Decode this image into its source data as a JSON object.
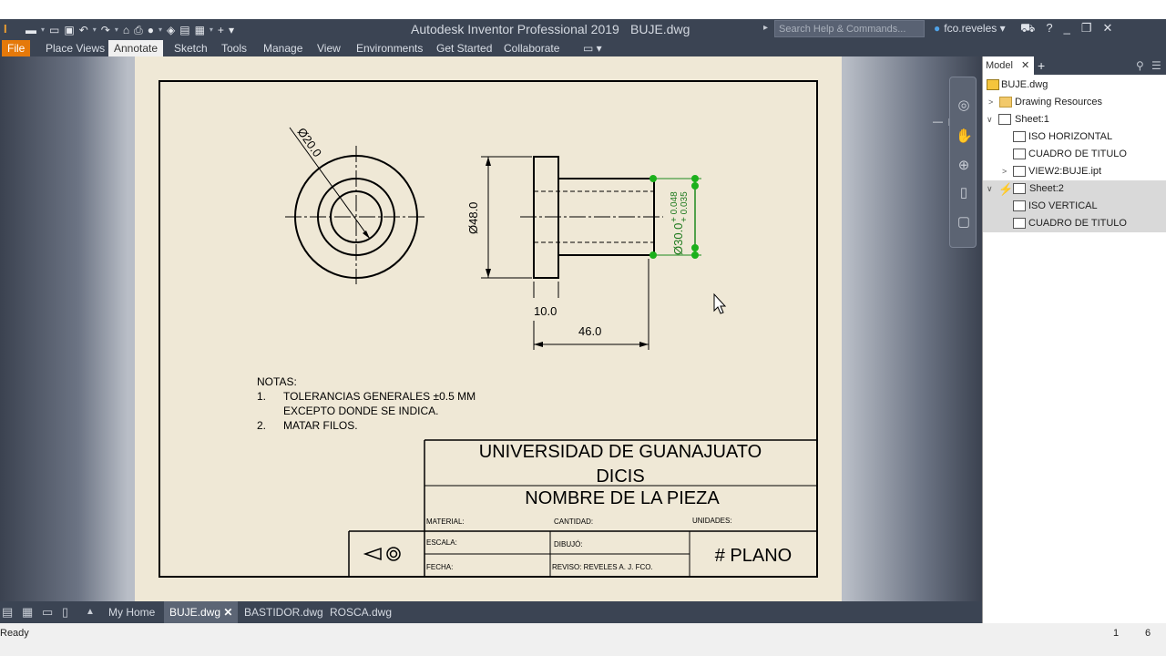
{
  "titlebar": {
    "app_title": "Autodesk Inventor Professional 2019",
    "file_name": "BUJE.dwg",
    "search_placeholder": "Search Help & Commands...",
    "user": "fco.reveles"
  },
  "ribbon": {
    "tabs": [
      "File",
      "Place Views",
      "Annotate",
      "Sketch",
      "Tools",
      "Manage",
      "View",
      "Environments",
      "Get Started",
      "Collaborate"
    ],
    "active": "Annotate"
  },
  "browser": {
    "tab": "Model",
    "items": [
      {
        "label": "BUJE.dwg"
      },
      {
        "label": "Drawing Resources"
      },
      {
        "label": "Sheet:1"
      },
      {
        "label": "ISO HORIZONTAL"
      },
      {
        "label": "CUADRO DE TITULO"
      },
      {
        "label": "VIEW2:BUJE.ipt"
      },
      {
        "label": "Sheet:2"
      },
      {
        "label": "ISO VERTICAL"
      },
      {
        "label": "CUADRO DE TITULO"
      }
    ]
  },
  "drawing": {
    "dims": {
      "d20": "Ø20.0",
      "d48": "Ø48.0",
      "d30": "Ø30.0",
      "tol_upper": "+ 0.048",
      "tol_lower": "+ 0.035",
      "len10": "10.0",
      "len46": "46.0"
    },
    "notes": {
      "heading": "NOTAS:",
      "n1_num": "1.",
      "n1_line1": "TOLERANCIAS GENERALES ±0.5 MM",
      "n1_line2": "EXCEPTO DONDE SE INDICA.",
      "n2_num": "2.",
      "n2_line1": "MATAR FILOS."
    },
    "titleblock": {
      "university": "UNIVERSIDAD DE GUANAJUATO",
      "campus": "DICIS",
      "part_name": "NOMBRE DE LA PIEZA",
      "material": "MATERIAL:",
      "cantidad": "CANTIDAD:",
      "unidades": "UNIDADES:",
      "escala": "ESCALA:",
      "dibujo": "DIBUJÓ:",
      "fecha": "FECHA:",
      "reviso": "REVISO: REVELES A. J. FCO.",
      "plano": "# PLANO"
    }
  },
  "doc_tabs": [
    "My Home",
    "BUJE.dwg",
    "BASTIDOR.dwg",
    "ROSCA.dwg"
  ],
  "doc_tab_active": "BUJE.dwg",
  "status": {
    "text": "Ready",
    "num1": "1",
    "num2": "6"
  }
}
